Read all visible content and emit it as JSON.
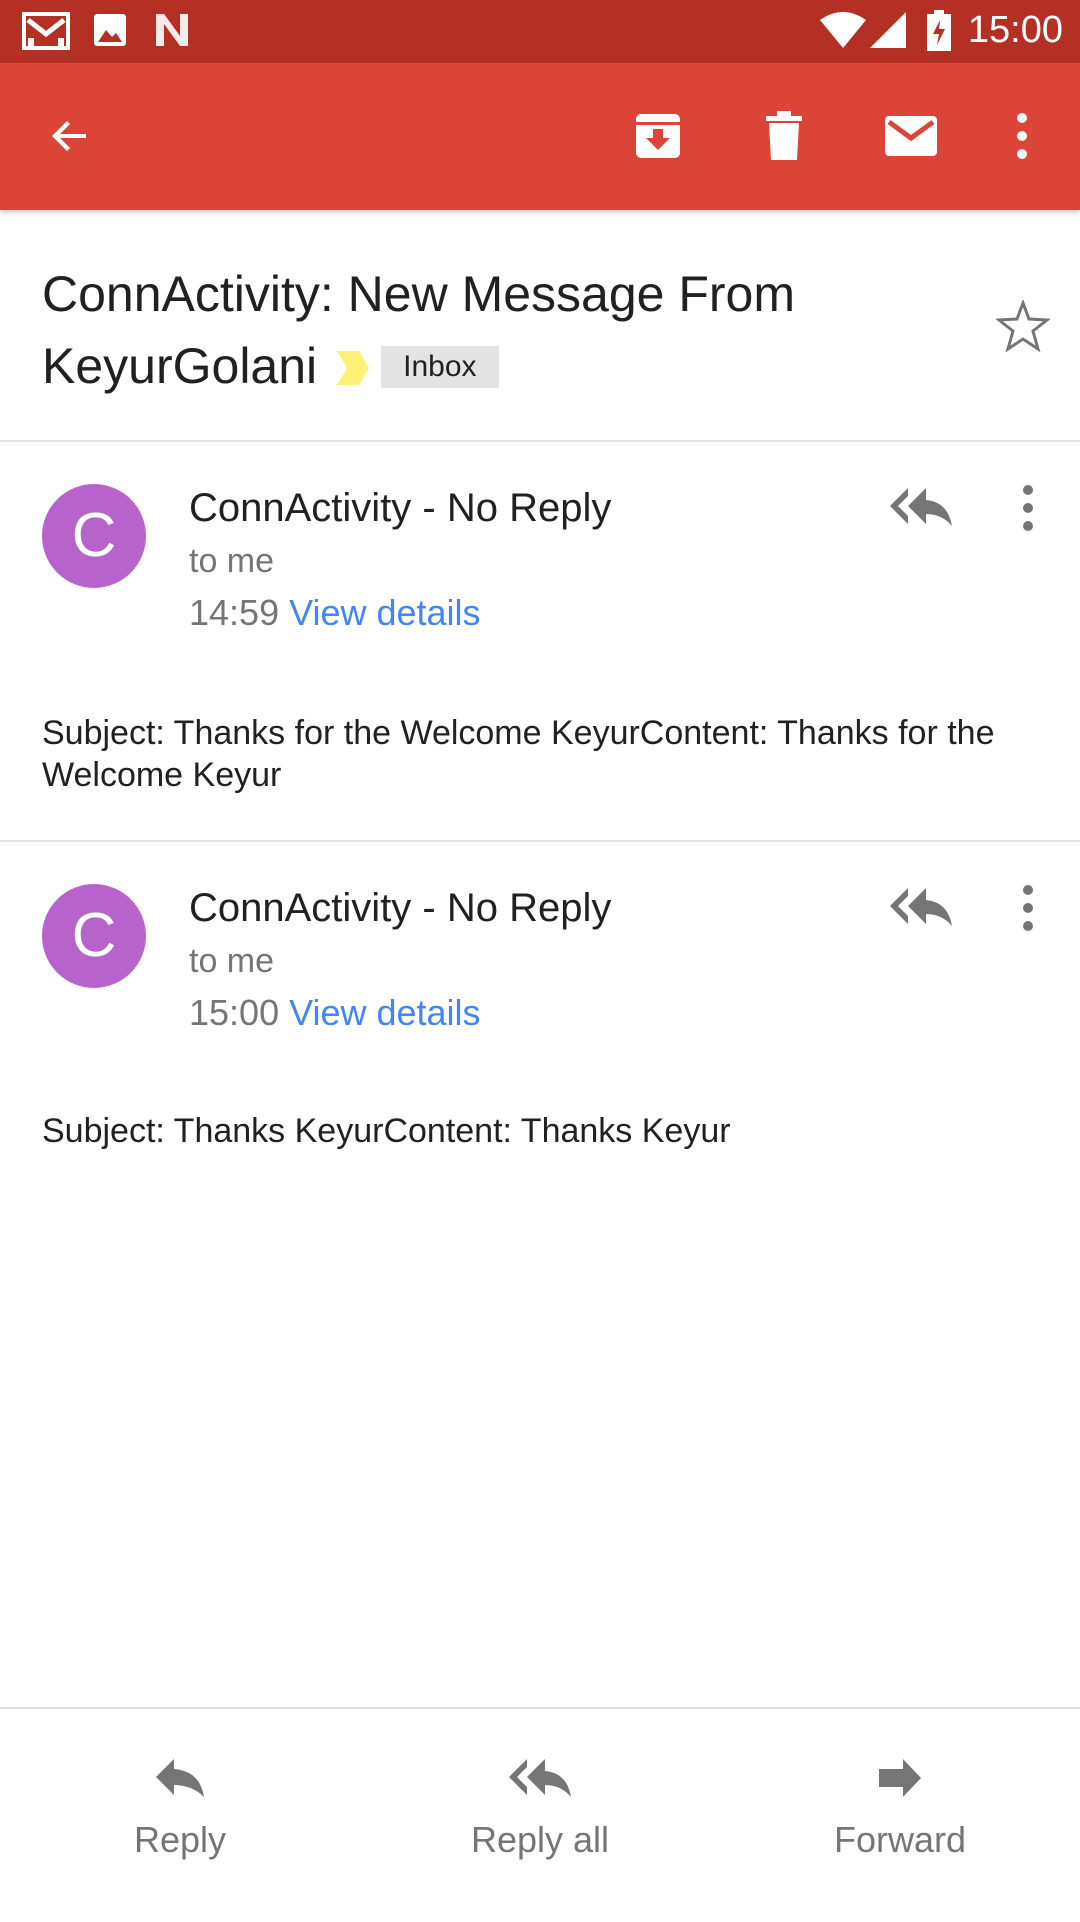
{
  "status_bar": {
    "time": "15:00",
    "left_icons": [
      "gmail-icon",
      "photo-icon",
      "n-icon"
    ],
    "right_icons": [
      "wifi-icon",
      "signal-icon",
      "battery-charging-icon"
    ]
  },
  "app_bar": {
    "color": "#db4437",
    "actions": [
      "back-arrow-icon",
      "archive-icon",
      "delete-icon",
      "mark-unread-icon",
      "overflow-menu-icon"
    ]
  },
  "thread": {
    "subject": "ConnActivity: New Message From KeyurGolani",
    "label": "Inbox",
    "starred": false
  },
  "messages": [
    {
      "avatar_letter": "C",
      "avatar_color": "#b863cc",
      "sender": "ConnActivity - No Reply",
      "recipient": "to me",
      "time": "14:59",
      "details_link": "View details",
      "body": "Subject: Thanks for the Welcome KeyurContent: Thanks for the Welcome Keyur"
    },
    {
      "avatar_letter": "C",
      "avatar_color": "#b863cc",
      "sender": "ConnActivity - No Reply",
      "recipient": "to me",
      "time": "15:00",
      "details_link": "View details",
      "body": "Subject: Thanks KeyurContent: Thanks Keyur"
    }
  ],
  "bottom_actions": {
    "reply": "Reply",
    "reply_all": "Reply all",
    "forward": "Forward"
  }
}
